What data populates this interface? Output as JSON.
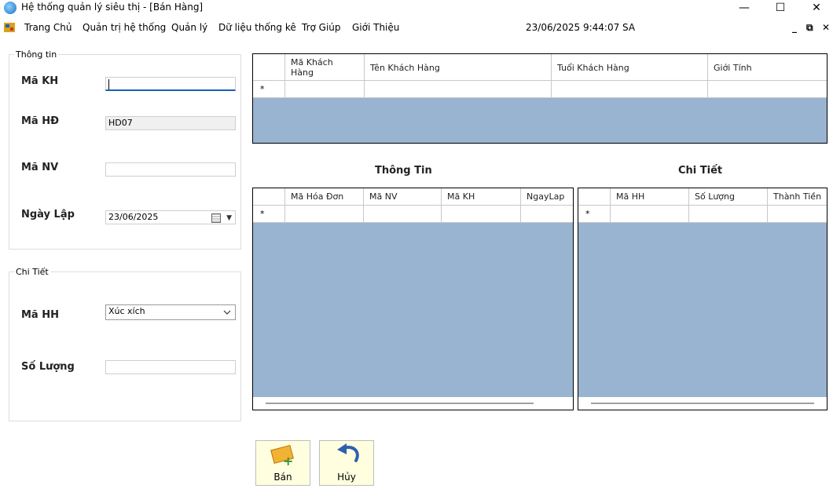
{
  "window": {
    "title": "Hệ thống quản lý siêu thị - [Bán Hàng]"
  },
  "menu": {
    "items": [
      "Trang Chủ",
      "Quản trị hệ thống",
      "Quản lý",
      "Dữ liệu thống kê",
      "Trợ Giúp",
      "Giới Thiệu"
    ],
    "clock": "23/06/2025 9:44:07 SA"
  },
  "thong_tin_group": {
    "title": "Thông tin",
    "ma_kh_label": "Mã KH",
    "ma_kh_value": "",
    "ma_hd_label": "Mã HĐ",
    "ma_hd_value": "HD07",
    "ma_nv_label": "Mã NV",
    "ma_nv_value": "",
    "ngay_lap_label": "Ngày Lập",
    "ngay_lap_value": "23/06/2025"
  },
  "chi_tiet_group": {
    "title": "Chi Tiết",
    "ma_hh_label": "Mã HH",
    "ma_hh_value": "Xúc xích",
    "so_luong_label": "Số Lượng",
    "so_luong_value": ""
  },
  "customer_grid": {
    "columns": [
      "Mã Khách Hàng",
      "Tên Khách Hàng",
      "Tuổi Khách Hàng",
      "Giới Tính"
    ],
    "new_row_marker": "*"
  },
  "thong_tin_section": {
    "title": "Thông Tin"
  },
  "chi_tiet_section": {
    "title": "Chi Tiết"
  },
  "invoice_grid": {
    "columns": [
      "Mã Hóa Đơn",
      "Mã NV",
      "Mã KH",
      "NgayLap"
    ],
    "new_row_marker": "*"
  },
  "detail_grid": {
    "columns": [
      "Mã HH",
      "Số Lượng",
      "Thành Tiền"
    ],
    "new_row_marker": "*"
  },
  "buttons": {
    "ban": "Bán",
    "huy": "Hủy"
  }
}
